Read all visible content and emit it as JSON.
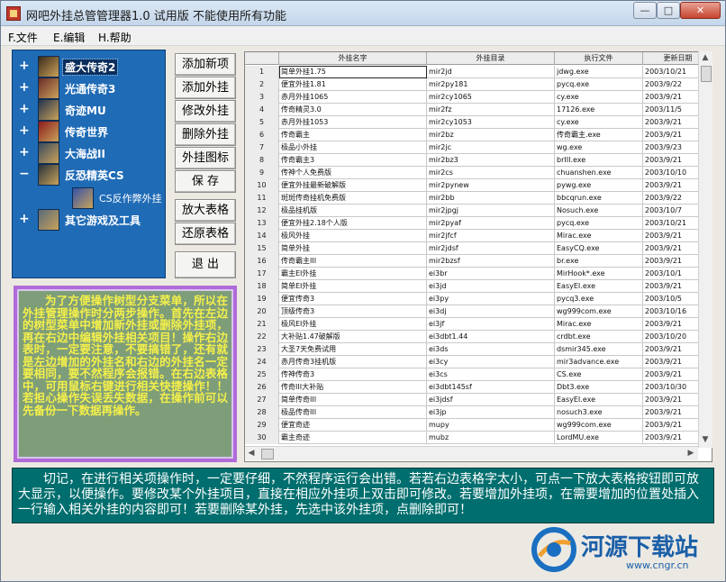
{
  "window": {
    "title": "网吧外挂总管管理器1.0  试用版   不能使用所有功能",
    "buttons": {
      "minimize": "—",
      "maximize": "□",
      "close": "✕"
    }
  },
  "menu": [
    "F.文件",
    "E.编辑",
    "H.帮助"
  ],
  "tree": {
    "nodes": [
      {
        "label": "盛大传奇2",
        "expander": "+",
        "icon": "legend2-game-icon",
        "icon_color": "#3b2a1a"
      },
      {
        "label": "光通传奇3",
        "expander": "+",
        "icon": "legend3-game-icon",
        "icon_color": "#6a2b2b"
      },
      {
        "label": "奇迹MU",
        "expander": "+",
        "icon": "mu-game-icon",
        "icon_color": "#24324d"
      },
      {
        "label": "传奇世界",
        "expander": "+",
        "icon": "woool-game-icon",
        "icon_color": "#8c1b1b"
      },
      {
        "label": "大海战II",
        "expander": "+",
        "icon": "navy-game-icon",
        "icon_color": "#3a4b5e"
      },
      {
        "label": "反恐精英CS",
        "expander": "−",
        "icon": "counterstrike-game-icon",
        "icon_color": "#26303a"
      },
      {
        "label": "CS反作弊外挂",
        "expander": "",
        "icon": "cs-anticheat-icon",
        "icon_color": "#3552a8",
        "child": true
      },
      {
        "label": "其它游戏及工具",
        "expander": "+",
        "icon": "other-tools-icon",
        "icon_color": "#5a6a7a"
      }
    ]
  },
  "buttons": {
    "add_item": "添加新项",
    "add_plugin": "添加外挂",
    "edit_plugin": "修改外挂",
    "delete_plugin": "删除外挂",
    "plugin_icon": "外挂图标",
    "save": "保  存",
    "zoom_table": "放大表格",
    "restore_table": "还原表格",
    "exit": "退  出"
  },
  "info_text": "为了方便操作树型分支菜单，所以在外挂管理操作时分两步操作。首先在左边的树型菜单中增加新外挂或删除外挂项，再在右边中编辑外挂相关项目！操作右边表时，一定要注意，不要搞错了，还有就是左边增加的外挂名和右边的外挂名一定要相同，要不然程序会报错。在右边表格中，可用鼠标右键进行相关快捷操作！！若担心操作失误丢失数据，在操作前可以先备份一下数据再操作。",
  "table": {
    "columns": [
      "",
      "外挂名字",
      "外挂目录",
      "执行文件",
      "更新日期"
    ],
    "rows": [
      [
        "1",
        "简单外挂1.75",
        "mir2jd",
        "jdwg.exe",
        "2003/10/21"
      ],
      [
        "2",
        "便宜外挂1.81",
        "mir2py181",
        "pycq.exe",
        "2003/9/22"
      ],
      [
        "3",
        "赤月外挂1065",
        "mir2cy1065",
        "cy.exe",
        "2003/9/21"
      ],
      [
        "4",
        "传奇精灵3.0",
        "mir2fz",
        "17126.exe",
        "2003/11/5"
      ],
      [
        "5",
        "赤月外挂1053",
        "mir2cy1053",
        "cy.exe",
        "2003/9/21"
      ],
      [
        "6",
        "传奇霸主",
        "mir2bz",
        "传奇霸主.exe",
        "2003/9/21"
      ],
      [
        "7",
        "极品小外挂",
        "mir2jc",
        "wg.exe",
        "2003/9/23"
      ],
      [
        "8",
        "传奇霸主3",
        "mir2bz3",
        "brIII.exe",
        "2003/9/21"
      ],
      [
        "9",
        "传神个人免费版",
        "mir2cs",
        "chuanshen.exe",
        "2003/10/10"
      ],
      [
        "10",
        "便宜外挂最新破解版",
        "mir2pynew",
        "pywg.exe",
        "2003/9/21"
      ],
      [
        "11",
        "斑斑传奇挂机免费版",
        "mir2bb",
        "bbcqrun.exe",
        "2003/9/22"
      ],
      [
        "12",
        "极品挂机版",
        "mir2jpgj",
        "Nosuch.exe",
        "2003/10/7"
      ],
      [
        "13",
        "便宜外挂2.18个人版",
        "mir2pyaf",
        "pycq.exe",
        "2003/10/21"
      ],
      [
        "14",
        "极风外挂",
        "mir2jfcf",
        "Mirac.exe",
        "2003/9/21"
      ],
      [
        "15",
        "简单外挂",
        "mir2jdsf",
        "EasyCQ.exe",
        "2003/9/21"
      ],
      [
        "16",
        "传奇霸主III",
        "mir2bzsf",
        "br.exe",
        "2003/9/21"
      ],
      [
        "17",
        "霸主EI外挂",
        "ei3br",
        "MirHook*.exe",
        "2003/10/1"
      ],
      [
        "18",
        "简单EI外挂",
        "ei3jd",
        "EasyEI.exe",
        "2003/9/21"
      ],
      [
        "19",
        "便宜传奇3",
        "ei3py",
        "pycq3.exe",
        "2003/10/5"
      ],
      [
        "20",
        "顶级传奇3",
        "ei3dj",
        "wg999com.exe",
        "2003/10/16"
      ],
      [
        "21",
        "极风EI外挂",
        "ei3jf",
        "Mirac.exe",
        "2003/9/21"
      ],
      [
        "22",
        "大补贴1.47破解版",
        "ei3dbt1.44",
        "crdbt.exe",
        "2003/10/20"
      ],
      [
        "23",
        "大圣7天免费试用",
        "ei3ds",
        "dsmir345.exe",
        "2003/9/21"
      ],
      [
        "24",
        "赤月传奇3挂机版",
        "ei3cy",
        "mir3advance.exe",
        "2003/9/21"
      ],
      [
        "25",
        "传神传奇3",
        "ei3cs",
        "CS.exe",
        "2003/9/21"
      ],
      [
        "26",
        "传奇III大补贴",
        "ei3dbt145sf",
        "Dbt3.exe",
        "2003/10/30"
      ],
      [
        "27",
        "简单传奇III",
        "ei3jdsf",
        "EasyEI.exe",
        "2003/9/21"
      ],
      [
        "28",
        "极品传奇III",
        "ei3jp",
        "nosuch3.exe",
        "2003/9/21"
      ],
      [
        "29",
        "便宜奇迹",
        "mupy",
        "wg999com.exe",
        "2003/9/21"
      ],
      [
        "30",
        "霸主奇迹",
        "mubz",
        "LordMU.exe",
        "2003/9/21"
      ]
    ]
  },
  "status_text": "切记，在进行相关项操作时，一定要仔细，不然程序运行会出错。若若右边表格字太小，可点一下放大表格按钮即可放大显示，以便操作。要修改某个外挂项目，直接在相应外挂项上双击即可修改。若要增加外挂项，在需要增加的位置处插入一行输入相关外挂的内容即可！若要删除某外挂，先选中该外挂项，点删除即可！",
  "watermark": {
    "text": "河源下载站",
    "url": "www.cngr.cn"
  }
}
